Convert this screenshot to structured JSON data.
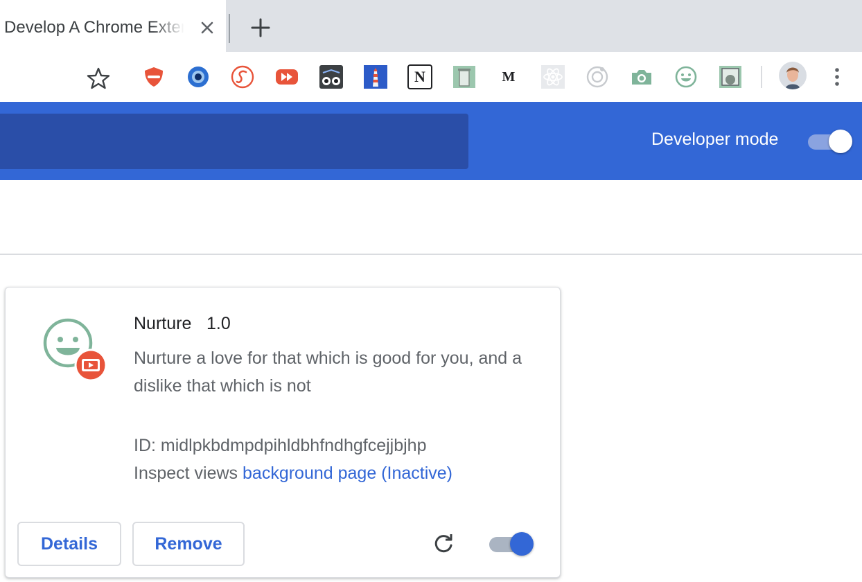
{
  "tab": {
    "title": "o Develop A Chrome Extension"
  },
  "toolbar": {
    "extensions": [
      "adblock-shield-icon",
      "eye-globe-icon",
      "scribble-s-icon",
      "fast-forward-icon",
      "owl-icon",
      "lighthouse-icon",
      "notion-icon",
      "trash-can-icon",
      "medium-m-icon",
      "react-atom-icon",
      "target-ring-icon",
      "camera-icon",
      "smiley-icon",
      "photo-frame-icon"
    ],
    "medium_letter": "M",
    "notion_letter": "N"
  },
  "header": {
    "developer_mode_label": "Developer mode",
    "developer_mode_on": true
  },
  "extension_card": {
    "name": "Nurture",
    "version": "1.0",
    "description": "Nurture a love for that which is good for you, and a dislike that which is not",
    "id_text": "ID: midlpkbdmpdpihldbhfndhgfcejjbjhp",
    "inspect_prefix": "Inspect views",
    "inspect_link": "background page (Inactive)",
    "details_label": "Details",
    "remove_label": "Remove",
    "enabled": true
  },
  "colors": {
    "header_blue": "#3367d6",
    "search_blue": "#2a4ea8",
    "link_blue": "#3367d6",
    "smiley_green": "#7fb49a",
    "badge_red": "#e8543a"
  }
}
